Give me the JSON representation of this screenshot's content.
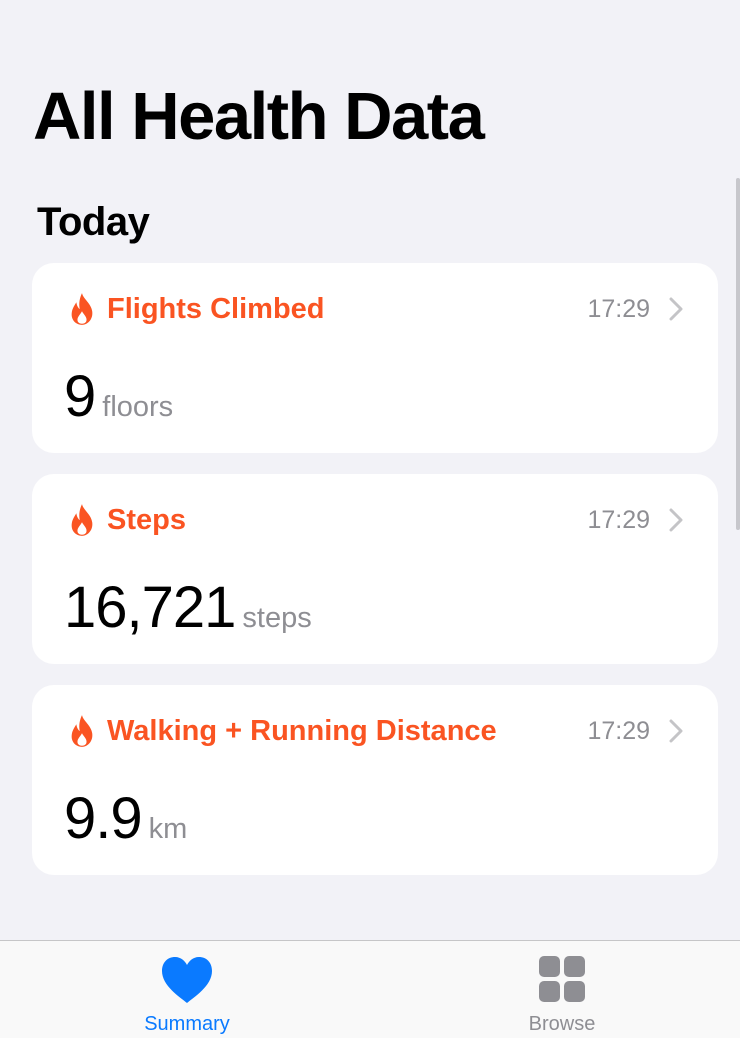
{
  "header": {
    "title": "All Health Data"
  },
  "section": {
    "title": "Today"
  },
  "cards": [
    {
      "title": "Flights Climbed",
      "time": "17:29",
      "value": "9",
      "unit": "floors",
      "icon": "flame-icon"
    },
    {
      "title": "Steps",
      "time": "17:29",
      "value": "16,721",
      "unit": "steps",
      "icon": "flame-icon"
    },
    {
      "title": "Walking + Running Distance",
      "time": "17:29",
      "value": "9.9",
      "unit": "km",
      "icon": "flame-icon"
    }
  ],
  "tabbar": {
    "tabs": [
      {
        "label": "Summary",
        "icon": "heart-icon",
        "selected": true
      },
      {
        "label": "Browse",
        "icon": "grid-icon",
        "selected": false
      }
    ]
  },
  "colors": {
    "accent": "#fa5422",
    "tint": "#0a7aff",
    "secondary_text": "#8e8e93",
    "background": "#f2f2f7",
    "card": "#ffffff"
  }
}
